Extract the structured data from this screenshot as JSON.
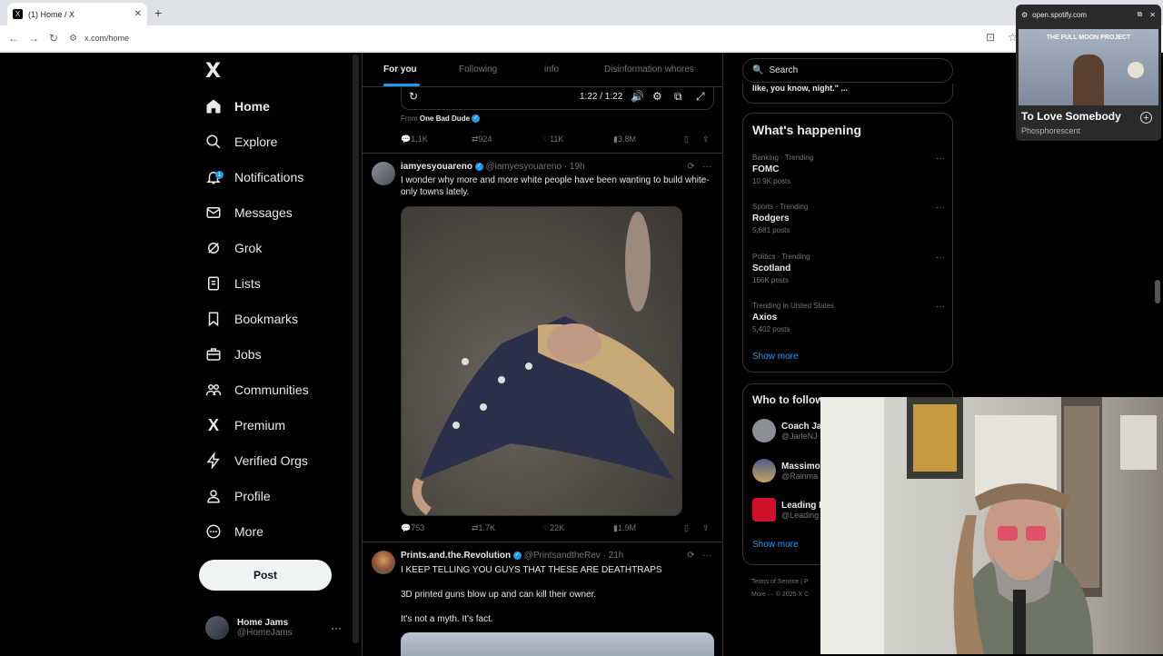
{
  "browser": {
    "tab_title": "(1) Home / X",
    "tab_favicon": "X",
    "url": "x.com/home"
  },
  "sidebar": {
    "logo": "X",
    "items": [
      {
        "label": "Home",
        "icon": "home-icon"
      },
      {
        "label": "Explore",
        "icon": "search-icon"
      },
      {
        "label": "Notifications",
        "icon": "bell-icon",
        "badge": "1"
      },
      {
        "label": "Messages",
        "icon": "mail-icon"
      },
      {
        "label": "Grok",
        "icon": "grok-icon"
      },
      {
        "label": "Lists",
        "icon": "list-icon"
      },
      {
        "label": "Bookmarks",
        "icon": "bookmark-icon"
      },
      {
        "label": "Jobs",
        "icon": "briefcase-icon"
      },
      {
        "label": "Communities",
        "icon": "people-icon"
      },
      {
        "label": "Premium",
        "icon": "x-icon"
      },
      {
        "label": "Verified Orgs",
        "icon": "lightning-icon"
      },
      {
        "label": "Profile",
        "icon": "person-icon"
      },
      {
        "label": "More",
        "icon": "more-circle-icon"
      }
    ],
    "post_label": "Post",
    "account": {
      "name": "Home Jams",
      "handle": "@HomeJams"
    }
  },
  "timeline": {
    "tabs": [
      "For you",
      "Following",
      "info",
      "Disinformation whores"
    ],
    "video_time": "1:22 / 1:22",
    "prev_tweet": {
      "from_label": "From",
      "from_name": "One Bad Dude",
      "stats": {
        "replies": "1.1K",
        "reposts": "924",
        "likes": "11K",
        "views": "3.8M"
      }
    },
    "tweet1": {
      "name": "iamyesyouareno",
      "handle": "@iamyesyouareno",
      "time": "· 19h",
      "text": "I wonder why more and more white people have been wanting to build white-only towns lately.",
      "stats": {
        "replies": "753",
        "reposts": "1.7K",
        "likes": "22K",
        "views": "1.9M"
      }
    },
    "tweet2": {
      "name": "Prints.and.the.Revolution",
      "handle": "@PrintsandtheRev",
      "time": "· 21h",
      "line1": "I KEEP TELLING YOU GUYS THAT THESE ARE DEATHTRAPS",
      "line2": "3D printed guns blow up and can kill their owner.",
      "line3": "It's not a myth. It's fact."
    }
  },
  "right": {
    "search_placeholder": "Search",
    "prev_card_text": "like, you know, night.\" ...",
    "happening_title": "What's happening",
    "trends": [
      {
        "context": "Banking · Trending",
        "name": "FOMC",
        "count": "10.9K posts"
      },
      {
        "context": "Sports · Trending",
        "name": "Rodgers",
        "count": "5,681 posts"
      },
      {
        "context": "Politics · Trending",
        "name": "Scotland",
        "count": "166K posts"
      },
      {
        "context": "Trending in United States",
        "name": "Axios",
        "count": "5,402 posts"
      }
    ],
    "show_more": "Show more",
    "follow_title": "Who to follow",
    "follow": [
      {
        "name": "Coach Ja",
        "handle": "@JarleNJ"
      },
      {
        "name": "Massimo",
        "handle": "@Rainma"
      },
      {
        "name": "Leading F",
        "handle": "@Leading"
      }
    ],
    "footer_line1": "Terms of Service  |  P",
    "footer_line2": "More ···   © 2025 X C"
  },
  "spotify": {
    "domain": "open.spotify.com",
    "album_text": "THE FULL MOON PROJECT",
    "track": "To Love Somebody",
    "artist": "Phosphorescent"
  },
  "colors": {
    "accent": "#1d9bf0",
    "bg": "#000000",
    "border": "#2f3336",
    "muted": "#71767b"
  }
}
